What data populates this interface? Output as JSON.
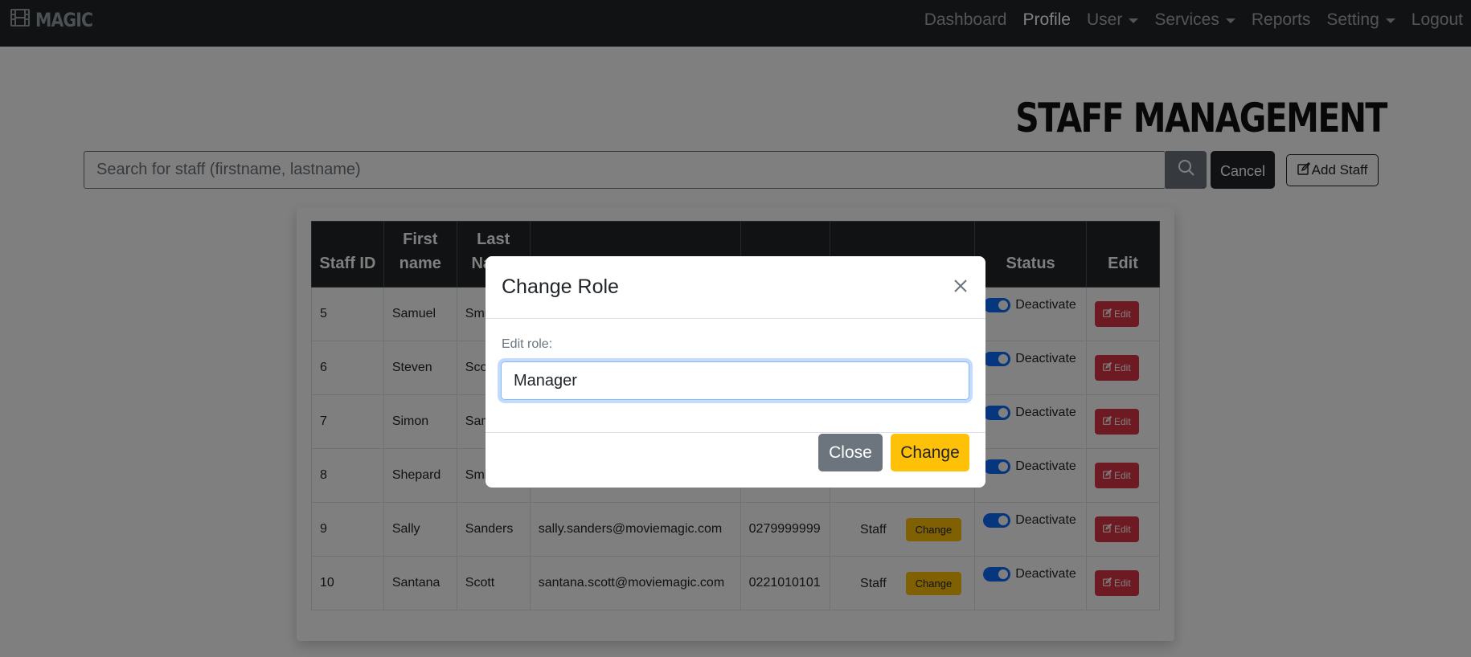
{
  "brand": "MAGIC",
  "nav": [
    {
      "label": "Dashboard",
      "dropdown": false,
      "active": false
    },
    {
      "label": "Profile",
      "dropdown": false,
      "active": true
    },
    {
      "label": "User",
      "dropdown": true,
      "active": false
    },
    {
      "label": "Services",
      "dropdown": true,
      "active": false
    },
    {
      "label": "Reports",
      "dropdown": false,
      "active": false
    },
    {
      "label": "Setting",
      "dropdown": true,
      "active": false
    },
    {
      "label": "Logout",
      "dropdown": false,
      "active": false
    }
  ],
  "page": {
    "title": "STAFF MANAGEMENT",
    "search_placeholder": "Search for staff (firstname, lastname)",
    "cancel_label": "Cancel",
    "add_label": "Add Staff"
  },
  "table": {
    "headers": [
      "Staff ID",
      "First name",
      "Last Name",
      "",
      "",
      "",
      "Status",
      "Edit"
    ],
    "change_label": "Change",
    "status_label": "Deactivate",
    "edit_label": "Edit",
    "rows": [
      {
        "id": "5",
        "first": "Samuel",
        "last": "Smith",
        "email": "",
        "phone": "",
        "role": ""
      },
      {
        "id": "6",
        "first": "Steven",
        "last": "Scott",
        "email": "",
        "phone": "",
        "role": ""
      },
      {
        "id": "7",
        "first": "Simon",
        "last": "Sanders",
        "email": "",
        "phone": "",
        "role": ""
      },
      {
        "id": "8",
        "first": "Shepard",
        "last": "Smith",
        "email": "",
        "phone": "",
        "role": ""
      },
      {
        "id": "9",
        "first": "Sally",
        "last": "Sanders",
        "email": "sally.sanders@moviemagic.com",
        "phone": "0279999999",
        "role": "Staff"
      },
      {
        "id": "10",
        "first": "Santana",
        "last": "Scott",
        "email": "santana.scott@moviemagic.com",
        "phone": "0221010101",
        "role": "Staff"
      }
    ]
  },
  "modal": {
    "title": "Change Role",
    "field_label": "Edit role:",
    "field_value": "Manager",
    "close_label": "Close",
    "change_label": "Change"
  },
  "colors": {
    "navbar": "#212529",
    "accent_yellow": "#ffc107",
    "danger": "#dc3545",
    "toggle": "#0d6efd",
    "secondary": "#6c757d"
  }
}
